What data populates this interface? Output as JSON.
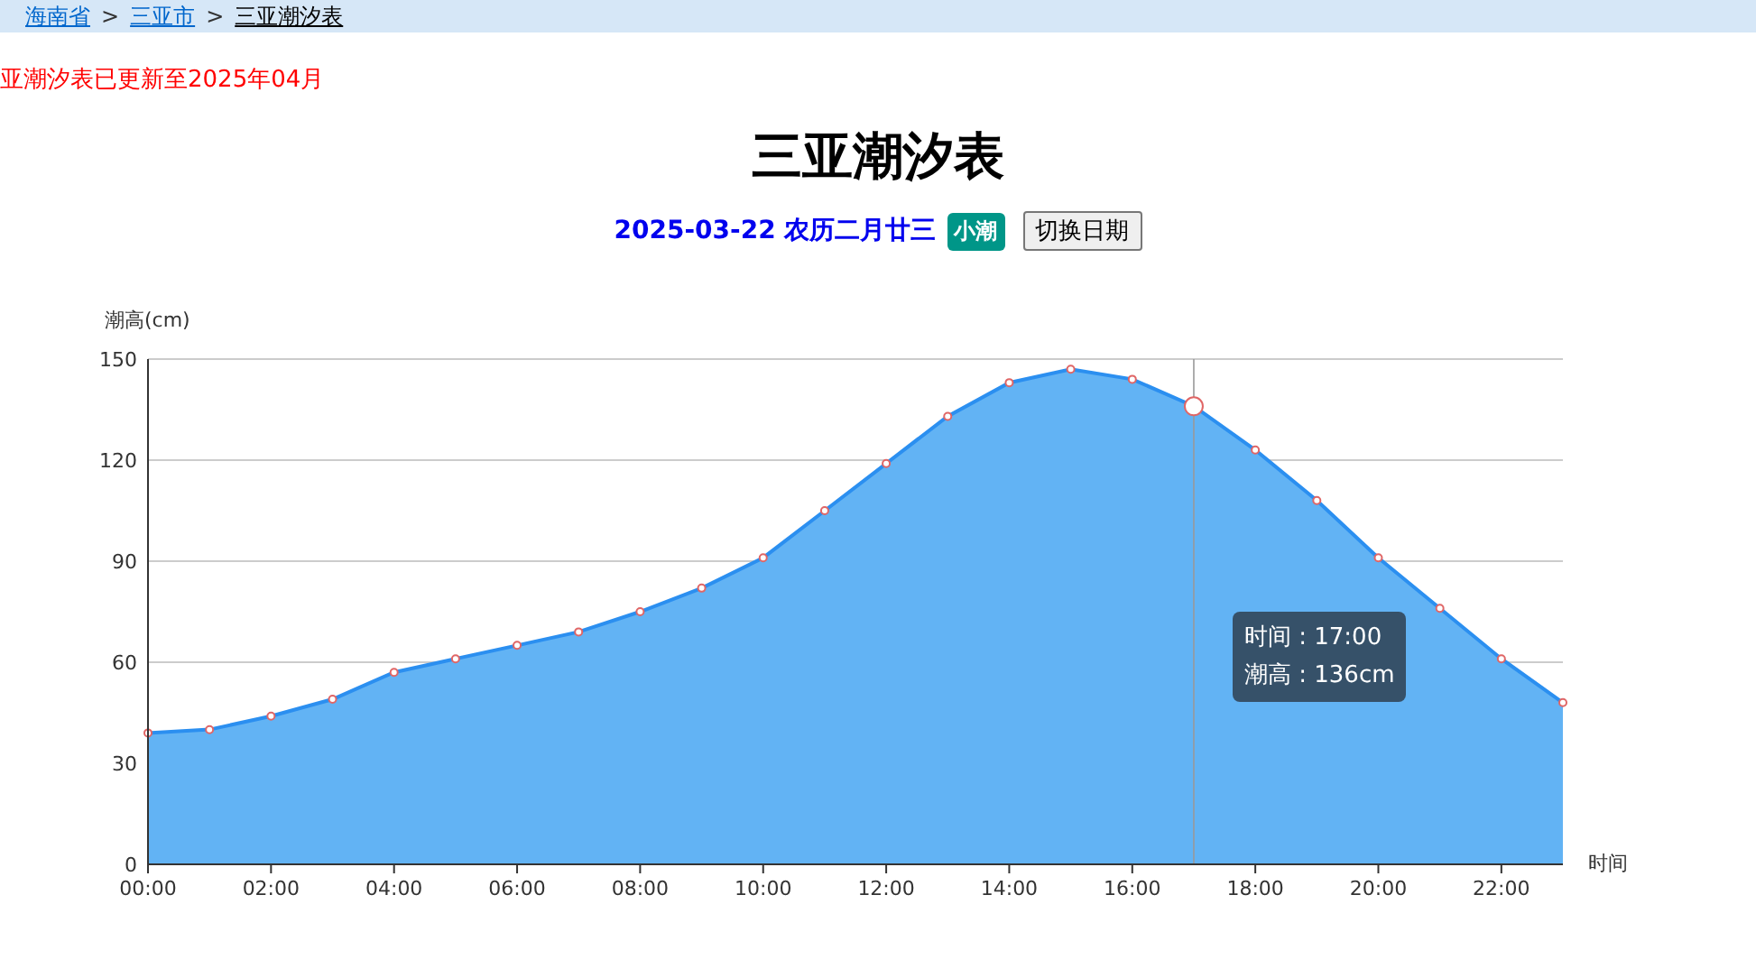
{
  "breadcrumb": [
    {
      "label": "海南省",
      "link": true
    },
    {
      "label": "三亚市",
      "link": true
    },
    {
      "label": "三亚潮汐表",
      "link": false
    }
  ],
  "breadcrumb_separator": ">",
  "notice": "亚潮汐表已更新至2025年04月",
  "title": "三亚潮汐表",
  "date_line": {
    "date": "2025-03-22",
    "lunar": "农历二月廿三",
    "tide_badge": "小潮",
    "button": "切换日期"
  },
  "chart": {
    "chart_data": {
      "type": "area",
      "ylabel": "潮高(cm)",
      "xlabel": "时间",
      "x": [
        0,
        1,
        2,
        3,
        4,
        5,
        6,
        7,
        8,
        9,
        10,
        11,
        12,
        13,
        14,
        15,
        16,
        17,
        18,
        19,
        20,
        21,
        22,
        23
      ],
      "grid": true,
      "xlim": [
        0,
        23
      ],
      "ref_lines": [
        {
          "axis": "x",
          "value": 17
        }
      ],
      "series": [
        {
          "name": "潮高",
          "color": "#2b8ff0",
          "values": [
            39,
            40,
            44,
            49,
            57,
            61,
            65,
            69,
            75,
            82,
            91,
            105,
            119,
            133,
            143,
            147,
            144,
            136,
            123,
            108,
            91,
            76,
            61,
            48
          ]
        }
      ],
      "ylim": [
        0,
        150
      ],
      "yticks": [
        0,
        30,
        60,
        90,
        120,
        150
      ],
      "xticks": [
        {
          "value": 0,
          "label": "00:00"
        },
        {
          "value": 2,
          "label": "02:00"
        },
        {
          "value": 4,
          "label": "04:00"
        },
        {
          "value": 6,
          "label": "06:00"
        },
        {
          "value": 8,
          "label": "08:00"
        },
        {
          "value": 10,
          "label": "10:00"
        },
        {
          "value": 12,
          "label": "12:00"
        },
        {
          "value": 14,
          "label": "14:00"
        },
        {
          "value": 16,
          "label": "16:00"
        },
        {
          "value": 18,
          "label": "18:00"
        },
        {
          "value": 20,
          "label": "20:00"
        },
        {
          "value": 22,
          "label": "22:00"
        }
      ]
    },
    "tooltip": {
      "separator": " : ",
      "time_label": "时间",
      "time": "17:00",
      "value": "136cm"
    }
  }
}
